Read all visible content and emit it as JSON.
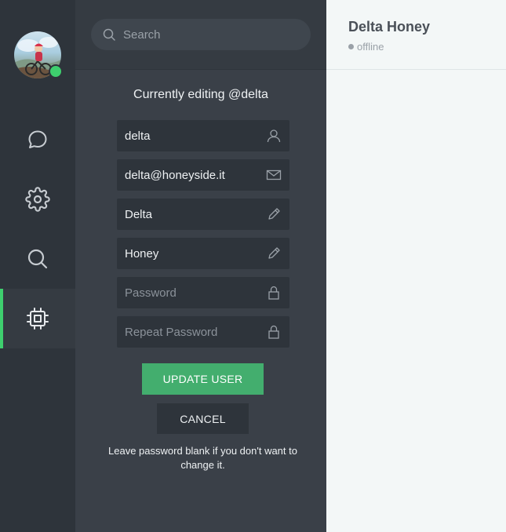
{
  "rail": {
    "items": [
      {
        "name": "chats",
        "icon": "chat-bubble-icon"
      },
      {
        "name": "settings",
        "icon": "gear-icon"
      },
      {
        "name": "search",
        "icon": "search-icon"
      },
      {
        "name": "admin",
        "icon": "cpu-chip-icon",
        "active": true
      }
    ],
    "avatar_status": "online"
  },
  "search": {
    "placeholder": "Search"
  },
  "editor": {
    "title": "Currently editing @delta",
    "fields": [
      {
        "value": "delta",
        "placeholder": "",
        "icon": "user-icon"
      },
      {
        "value": "delta@honeyside.it",
        "placeholder": "",
        "icon": "envelope-icon"
      },
      {
        "value": "Delta",
        "placeholder": "",
        "icon": "pencil-icon"
      },
      {
        "value": "Honey",
        "placeholder": "",
        "icon": "pencil-icon"
      },
      {
        "value": "",
        "placeholder": "Password",
        "icon": "lock-icon"
      },
      {
        "value": "",
        "placeholder": "Repeat Password",
        "icon": "lock-icon"
      }
    ],
    "update_label": "UPDATE USER",
    "cancel_label": "CANCEL",
    "note": "Leave password blank if you don't want to change it."
  },
  "chat": {
    "name": "Delta Honey",
    "status": "offline"
  },
  "colors": {
    "accent": "#43ae6e",
    "online": "#3ecf6e",
    "rail_bg": "#2e343b",
    "panel_bg": "#3a4048"
  }
}
